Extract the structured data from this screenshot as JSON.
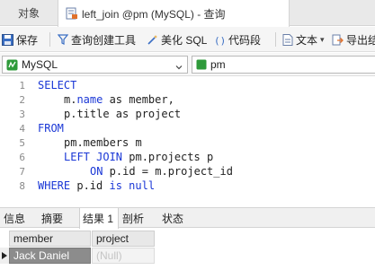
{
  "tabs": {
    "objects_label": "对象",
    "query_label": "left_join @pm (MySQL) - 查询"
  },
  "toolbar": {
    "save": "保存",
    "query_builder": "查询创建工具",
    "beautify": "美化 SQL",
    "snippet": "代码段",
    "text": "文本",
    "export": "导出结"
  },
  "selectors": {
    "connection": "MySQL",
    "database": "pm"
  },
  "editor": {
    "line_numbers": [
      "1",
      "2",
      "3",
      "4",
      "5",
      "6",
      "7",
      "8"
    ],
    "lines": {
      "l1_kw": "SELECT",
      "l2_a": "m.",
      "l2_b": "name",
      "l2_c": " as member,",
      "l3": "p.title as project",
      "l4_kw": "FROM",
      "l5": "pm.members m",
      "l6_kw": "LEFT JOIN",
      "l6_rest": " pm.projects p",
      "l7_kw": "ON",
      "l7_rest": " p.id = m.project_id",
      "l8_kw1": "WHERE",
      "l8_mid": " p.id ",
      "l8_kw2": "is null"
    }
  },
  "bottom_tabs": [
    "信息",
    "摘要",
    "结果 1",
    "剖析",
    "状态"
  ],
  "result": {
    "columns": [
      "member",
      "project"
    ],
    "rows": [
      {
        "member": "Jack Daniel",
        "project": "(Null)"
      }
    ]
  },
  "colors": {
    "keyword": "#1a37d6",
    "selected_cell": "#8c8c8c"
  }
}
